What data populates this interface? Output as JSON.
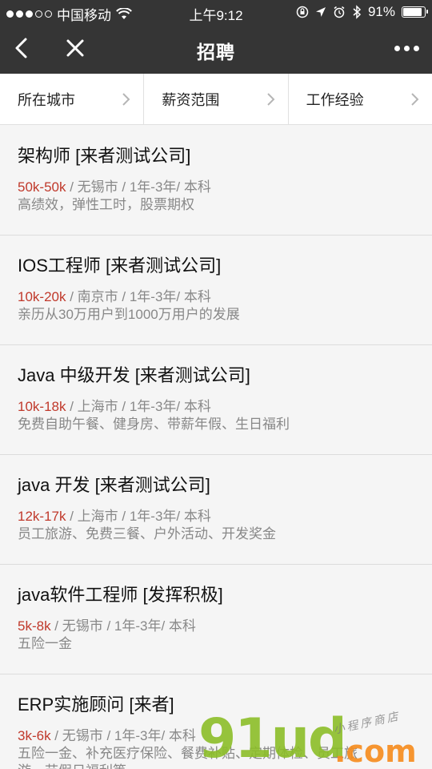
{
  "status_bar": {
    "carrier": "中国移动",
    "time": "上午9:12",
    "battery": "91%",
    "battery_level": 0.91
  },
  "navbar": {
    "title": "招聘"
  },
  "filters": [
    {
      "label": "所在城市"
    },
    {
      "label": "薪资范围"
    },
    {
      "label": "工作经验"
    }
  ],
  "jobs": [
    {
      "title": "架构师 [来者测试公司]",
      "salary": "50k-50k",
      "details": " / 无锡市 / 1年-3年/ 本科",
      "perks": "高绩效，弹性工时，股票期权"
    },
    {
      "title": "IOS工程师 [来者测试公司]",
      "salary": "10k-20k",
      "details": " / 南京市 / 1年-3年/ 本科",
      "perks": "亲历从30万用户到1000万用户的发展"
    },
    {
      "title": "Java 中级开发 [来者测试公司]",
      "salary": "10k-18k",
      "details": " / 上海市 / 1年-3年/ 本科",
      "perks": "免费自助午餐、健身房、带薪年假、生日福利"
    },
    {
      "title": "java 开发 [来者测试公司]",
      "salary": "12k-17k",
      "details": " / 上海市 / 1年-3年/ 本科",
      "perks": "员工旅游、免费三餐、户外活动、开发奖金"
    },
    {
      "title": "java软件工程师 [发挥积极]",
      "salary": "5k-8k",
      "details": " / 无锡市 / 1年-3年/ 本科",
      "perks": "五险一金"
    },
    {
      "title": "ERP实施顾问 [来者]",
      "salary": "3k-6k",
      "details": " / 无锡市 / 1年-3年/ 本科",
      "perks": "五险一金、补充医疗保险、餐费补贴、定期体检、员工旅",
      "perks2": "游、节假日福利等"
    }
  ],
  "watermark": {
    "main": "91ud",
    "com": ".com",
    "small": "小程序商店"
  }
}
